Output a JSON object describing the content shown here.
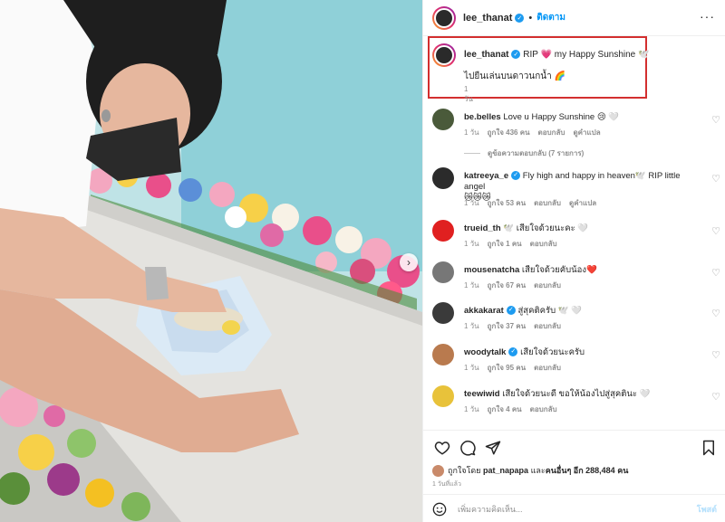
{
  "post": {
    "username": "lee_thanat",
    "follow_label": "ติดตาม",
    "caption_line1": "RIP 💗 my Happy Sunshine 🕊️",
    "caption_line2": "ไปยืนเล่นบนดาวนกน้ำ 🌈",
    "caption_time": "1 วัน"
  },
  "comments": [
    {
      "username": "be.belles",
      "text": "Love u Happy Sunshine 😢 🤍",
      "time": "1 วัน",
      "likes": "ถูกใจ 436 คน",
      "reply": "ตอบกลับ",
      "translate": "ดูคำแปล",
      "avatar_color": "#4a5a3a",
      "verified": false
    },
    {
      "username": "katreeya_e",
      "text": "Fly high and happy in heaven🕊️ RIP little angel",
      "text2": "😿😿😿",
      "time": "1 วัน",
      "likes": "ถูกใจ 53 คน",
      "reply": "ตอบกลับ",
      "translate": "ดูคำแปล",
      "avatar_color": "#2b2b2b",
      "verified": true
    },
    {
      "username": "trueid_th",
      "text": "🕊️ เสียใจด้วยนะคะ 🤍",
      "time": "1 วัน",
      "likes": "ถูกใจ 1 คน",
      "reply": "ตอบกลับ",
      "avatar_color": "#e02020",
      "verified": false
    },
    {
      "username": "mousenatcha",
      "text": "เสียใจด้วยคับน้อง❤️",
      "time": "1 วัน",
      "likes": "ถูกใจ 67 คน",
      "reply": "ตอบกลับ",
      "avatar_color": "#777777",
      "verified": false
    },
    {
      "username": "akkakarat",
      "text": "สู่สุคติครับ 🕊️ 🤍",
      "time": "1 วัน",
      "likes": "ถูกใจ 37 คน",
      "reply": "ตอบกลับ",
      "avatar_color": "#3a3a3a",
      "verified": true
    },
    {
      "username": "woodytalk",
      "text": "เสียใจด้วยนะครับ",
      "time": "1 วัน",
      "likes": "ถูกใจ 95 คน",
      "reply": "ตอบกลับ",
      "avatar_color": "#b97a4e",
      "verified": true
    },
    {
      "username": "teewiwid",
      "text": "เสียใจด้วยนะดี ขอให้น้องไปสู่สุคตินะ 🤍",
      "time": "1 วัน",
      "likes": "ถูกใจ 4 คน",
      "reply": "ตอบกลับ",
      "avatar_color": "#e8c23a",
      "verified": false
    }
  ],
  "view_replies": "ดูข้อความตอบกลับ (7 รายการ)",
  "likes_summary": {
    "prefix": "ถูกใจโดย",
    "user": "pat_napapa",
    "middle": "และ",
    "others": "คนอื่นๆ อีก 288,484 คน"
  },
  "post_time": "1 วันที่แล้ว",
  "add_comment": {
    "placeholder": "เพิ่มความคิดเห็น...",
    "post_label": "โพสต์"
  },
  "icons": [
    "heart-icon",
    "comment-icon",
    "share-icon",
    "bookmark-icon",
    "emoji-icon",
    "more-icon",
    "verified-icon"
  ],
  "colors": {
    "accent": "#0095f6",
    "highlight_box": "#d32f2f",
    "muted": "#8e8e8e"
  }
}
